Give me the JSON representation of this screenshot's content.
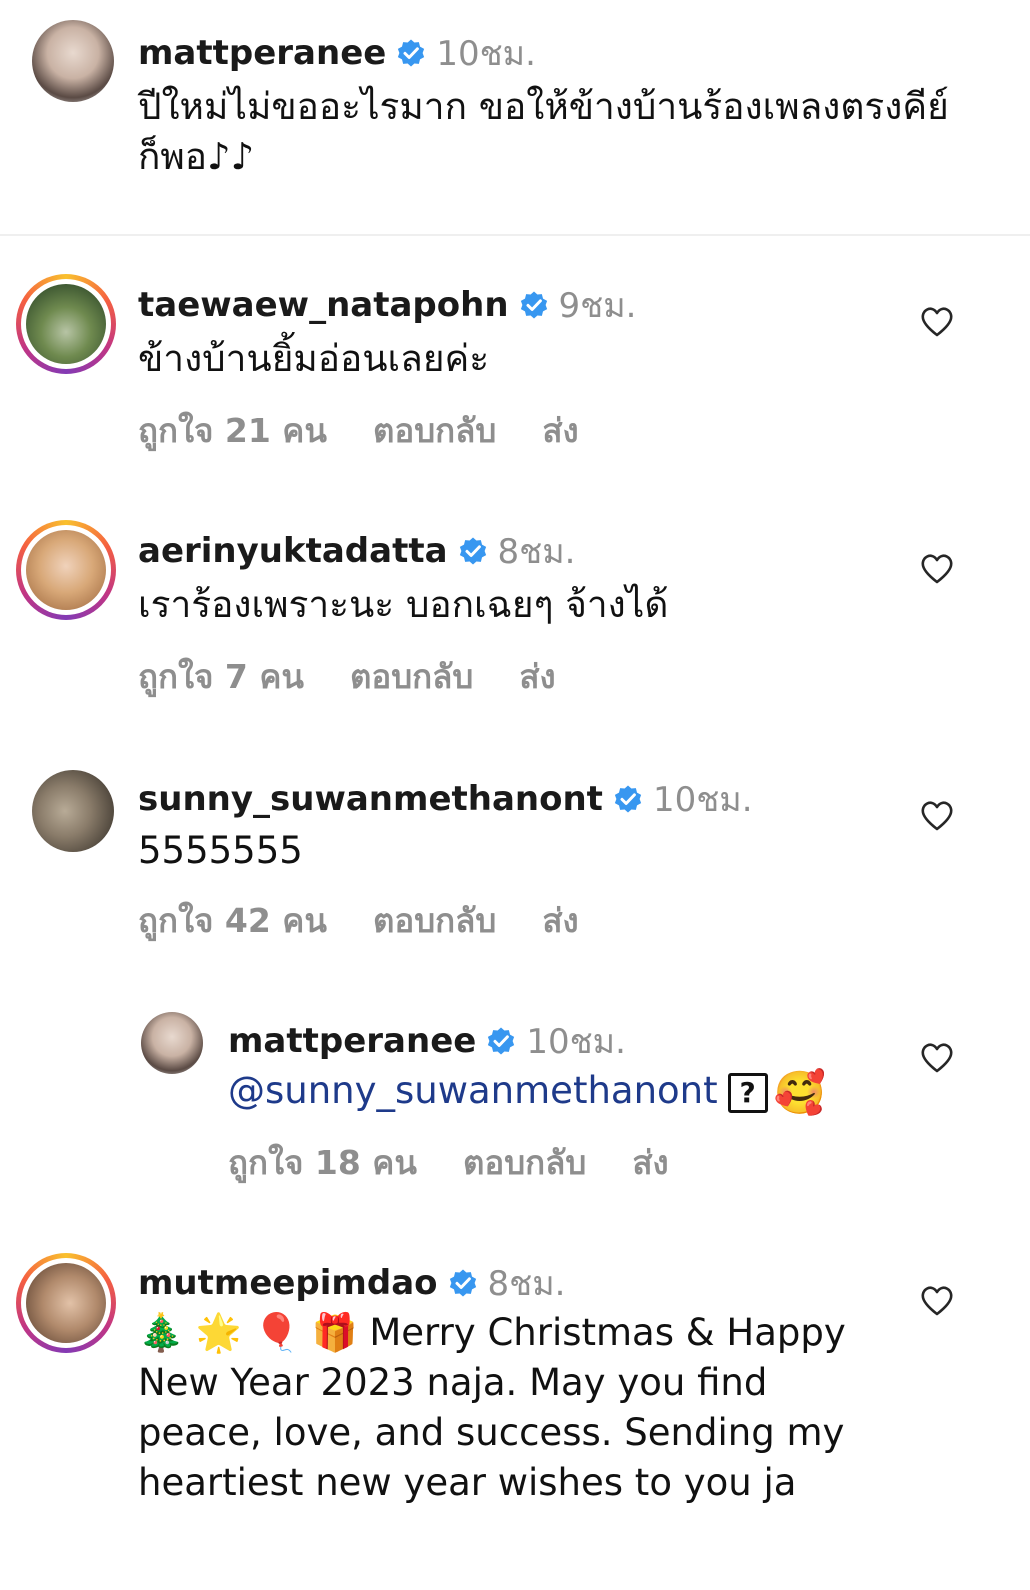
{
  "caption": {
    "username": "mattperanee",
    "time": "10ชม.",
    "text": "ปีใหม่ไม่ขออะไรมาก ขอให้ข้างบ้านร้องเพลงตรงคีย์ก็พอ♪♪"
  },
  "comments": [
    {
      "username": "taewaew_natapohn",
      "time": "9ชม.",
      "text": "ข้างบ้านยิ้มอ่อนเลยค่ะ",
      "likes": "ถูกใจ 21 คน",
      "reply": "ตอบกลับ",
      "send": "ส่ง"
    },
    {
      "username": "aerinyuktadatta",
      "time": "8ชม.",
      "text": "เราร้องเพราะนะ บอกเฉยๆ จ้างได้",
      "likes": "ถูกใจ 7 คน",
      "reply": "ตอบกลับ",
      "send": "ส่ง"
    },
    {
      "username": "sunny_suwanmethanont",
      "time": "10ชม.",
      "text": "5555555",
      "likes": "ถูกใจ 42 คน",
      "reply": "ตอบกลับ",
      "send": "ส่ง"
    },
    {
      "username": "mattperanee",
      "time": "10ชม.",
      "mention": "@sunny_suwanmethanont",
      "qmark": "?",
      "emoji": "🥰",
      "likes": "ถูกใจ 18 คน",
      "reply": "ตอบกลับ",
      "send": "ส่ง"
    },
    {
      "username": "mutmeepimdao",
      "time": "8ชม.",
      "emojis": "🎄 🌟 🎈 🎁",
      "text": "Merry Christmas & Happy New Year 2023 naja. May you find peace, love, and success. Sending my heartiest new year wishes to you ja"
    }
  ],
  "colors": {
    "verified": "#3897f0",
    "muted": "#8e8e8e",
    "mention": "#1e3a8a"
  }
}
